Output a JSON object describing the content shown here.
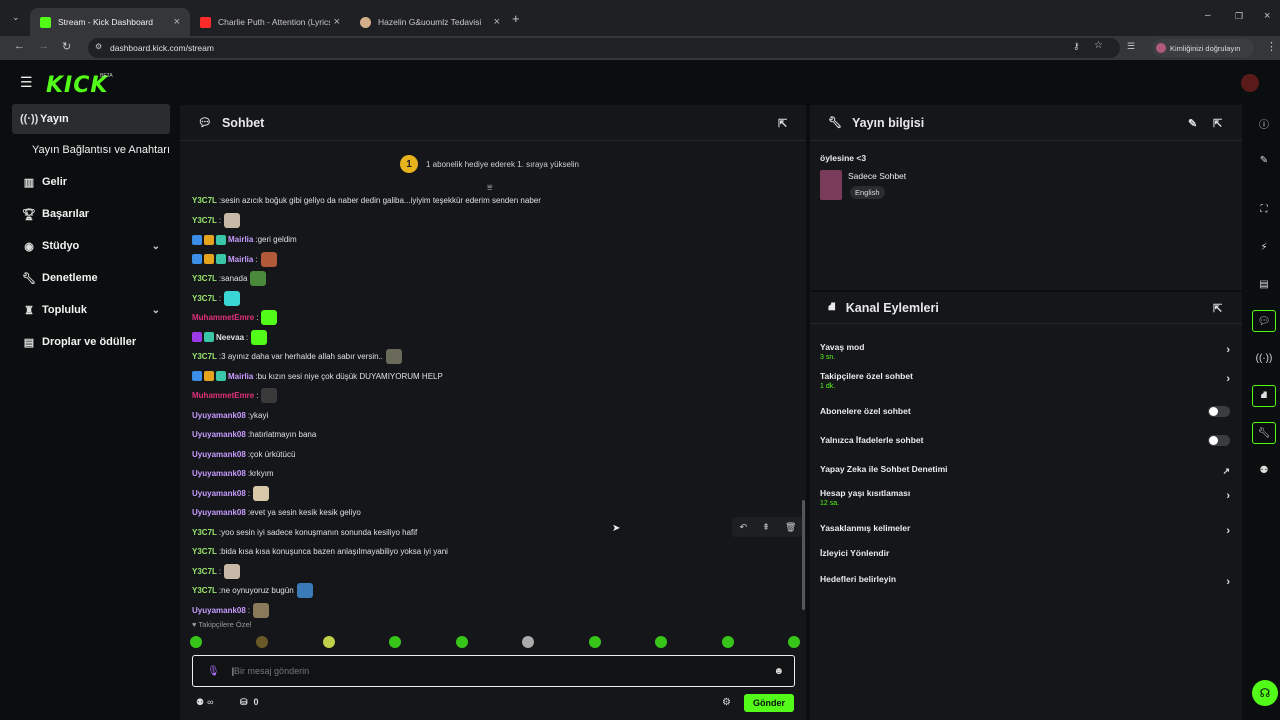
{
  "browser": {
    "tabs": [
      {
        "title": "Stream - Kick Dashboard",
        "fav": "#53fc18",
        "active": true
      },
      {
        "title": "Charlie Puth - Attention (Lyrics)",
        "fav": "#ff2a2a",
        "active": false
      },
      {
        "title": "Hazelin G&uoumlz Tedavisi",
        "fav": "#d4b08a",
        "active": false
      }
    ],
    "url": "dashboard.kick.com/stream",
    "profile": "Kimliğinizi doğrulayın"
  },
  "app": {
    "logo": "KICK",
    "beta": "BETA",
    "accent": "#53fc18"
  },
  "sidebar": {
    "items": [
      {
        "label": "Yayın",
        "icon": "broadcast-icon",
        "selected": true
      },
      {
        "label": "Yayın Bağlantısı ve Anahtarı",
        "sub": true
      },
      {
        "label": "Gelir",
        "icon": "bar-chart-icon"
      },
      {
        "label": "Başarılar",
        "icon": "trophy-icon"
      },
      {
        "label": "Stüdyo",
        "icon": "studio-icon",
        "chevron": true
      },
      {
        "label": "Denetleme",
        "icon": "wrench-icon"
      },
      {
        "label": "Topluluk",
        "icon": "community-icon",
        "chevron": true
      },
      {
        "label": "Droplar ve ödüller",
        "icon": "drops-icon"
      }
    ]
  },
  "chat": {
    "title": "Sohbet",
    "gift_text": "1 abonelik hediye ederek 1. sıraya yükselin",
    "gift_rank": "1",
    "lines": [
      {
        "user": "Y3C7L",
        "color": "#9ae66e",
        "text": "sesin azıcık boğuk gibi geliyo da naber dedin galiba...iyiyim teşekkür ederim senden naber",
        "badges": []
      },
      {
        "user": "Y3C7L",
        "color": "#9ae66e",
        "text": "",
        "badges": [],
        "emote": "#c8b8a8"
      },
      {
        "user": "Mairlia",
        "color": "#c79cff",
        "text": "geri geldim",
        "badges": [
          "#3a8ee6",
          "#e6a41e",
          "#3ac6a6"
        ]
      },
      {
        "user": "Mairlia",
        "color": "#c79cff",
        "text": "",
        "badges": [
          "#3a8ee6",
          "#e6a41e",
          "#3ac6a6"
        ],
        "emote": "#b05a3a"
      },
      {
        "user": "Y3C7L",
        "color": "#9ae66e",
        "text": "sanada",
        "badges": [],
        "emote": "#4a8a3a"
      },
      {
        "user": "Y3C7L",
        "color": "#9ae66e",
        "text": "",
        "badges": [],
        "emote": "#3ad6d6"
      },
      {
        "user": "MuhammetEmre",
        "color": "#e0307a",
        "text": "",
        "badges": [],
        "emote": "#53fc18"
      },
      {
        "user": "Neevaa",
        "color": "#e0e0e0",
        "text": "",
        "badges": [
          "#9a3ae6",
          "#3ac6a6"
        ],
        "emote": "#53fc18"
      },
      {
        "user": "Y3C7L",
        "color": "#9ae66e",
        "text": "3 ayınız daha var herhalde allah sabır versin..",
        "badges": [],
        "emote": "#6a6a5a"
      },
      {
        "user": "Mairlia",
        "color": "#c79cff",
        "text": "bu kızın sesi niye çok düşük DUYAMIYORUM HELP",
        "badges": [
          "#3a8ee6",
          "#e6a41e",
          "#3ac6a6"
        ]
      },
      {
        "user": "MuhammetEmre",
        "color": "#e0307a",
        "text": "",
        "badges": [],
        "emote": "#3a3a3a"
      },
      {
        "user": "Uyuyamank08",
        "color": "#c79cff",
        "text": "ykayi",
        "badges": []
      },
      {
        "user": "Uyuyamank08",
        "color": "#c79cff",
        "text": "hatırlatmayın bana",
        "badges": []
      },
      {
        "user": "Uyuyamank08",
        "color": "#c79cff",
        "text": "çok ürkütücü",
        "badges": []
      },
      {
        "user": "Uyuyamank08",
        "color": "#c79cff",
        "text": "krkyım",
        "badges": []
      },
      {
        "user": "Uyuyamank08",
        "color": "#c79cff",
        "text": "",
        "badges": [],
        "emote": "#d8c8a8"
      },
      {
        "user": "Uyuyamank08",
        "color": "#c79cff",
        "text": "evet ya sesin kesik kesik geliyo",
        "badges": []
      },
      {
        "user": "Y3C7L",
        "color": "#9ae66e",
        "text": "yoo sesin iyi sadece konuşmanın sonunda kesiliyo hafif",
        "badges": []
      },
      {
        "user": "Y3C7L",
        "color": "#9ae66e",
        "text": "bida kısa kısa konuşunca bazen anlaşılmayabiliyo yoksa iyi yani",
        "badges": []
      },
      {
        "user": "Y3C7L",
        "color": "#9ae66e",
        "text": "",
        "badges": [],
        "emote": "#c8b8a8"
      },
      {
        "user": "Y3C7L",
        "color": "#9ae66e",
        "text": "ne oynuyoruz bugün",
        "badges": [],
        "emote": "#3a7ab8"
      },
      {
        "user": "Uyuyamank08",
        "color": "#c79cff",
        "text": "",
        "badges": [],
        "emote": "#8a7a5a"
      }
    ],
    "followers_only_label": "Takipçilere Özel",
    "input_placeholder": "Bir mesaj gönderin",
    "infinity": "∞",
    "gift_count": "0",
    "send_label": "Gönder"
  },
  "stream_info": {
    "title": "Yayın bilgisi",
    "stream_title": "öylesine <3",
    "category": "Sadece Sohbet",
    "tag": "English"
  },
  "channel_actions": {
    "title": "Kanal Eylemleri",
    "rows": [
      {
        "label": "Yavaş mod",
        "sub": "3 sn.",
        "control": "arrow"
      },
      {
        "label": "Takipçilere özel sohbet",
        "sub": "1 dk.",
        "control": "arrow"
      },
      {
        "label": "Abonelere özel sohbet",
        "sub": "",
        "control": "toggle"
      },
      {
        "label": "Yalnızca İfadelerle sohbet",
        "sub": "",
        "control": "toggle"
      },
      {
        "label": "Yapay Zeka ile Sohbet Denetimi",
        "sub": "",
        "control": "external"
      },
      {
        "label": "Hesap yaşı kısıtlaması",
        "sub": "12 sa.",
        "control": "arrow"
      },
      {
        "label": "Yasaklanmış kelimeler",
        "sub": "",
        "control": "arrow"
      },
      {
        "label": "İzleyici Yönlendir",
        "sub": "",
        "control": "none"
      },
      {
        "label": "Hedefleri belirleyin",
        "sub": "",
        "control": "arrow"
      }
    ]
  }
}
